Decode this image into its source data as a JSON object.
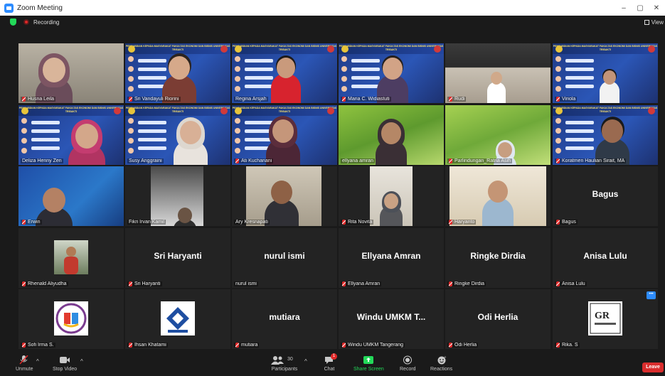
{
  "window": {
    "title": "Zoom Meeting",
    "min": "–",
    "max": "▢",
    "close": "✕"
  },
  "status": {
    "recording": "Recording",
    "view": "View"
  },
  "slide_banner": "PENGABDIAN KEPADA MASYARAKAT FAKULTAS EKONOMI DAN BISNIS UNIVERSITAS TRISAKTI",
  "participants": [
    {
      "name": "Husna Leila",
      "kind": "camera",
      "muted": true
    },
    {
      "name": "Sri Vandayuli Riorini",
      "kind": "slide",
      "muted": true
    },
    {
      "name": "Regina Arsjah",
      "kind": "slide",
      "muted": false
    },
    {
      "name": "Maria C. Widiastuti",
      "kind": "slide",
      "muted": true
    },
    {
      "name": "Rudi",
      "kind": "camera",
      "muted": true
    },
    {
      "name": "Viriola",
      "kind": "slide",
      "muted": true
    },
    {
      "name": "Deliza Henny Zen",
      "kind": "slide",
      "muted": false
    },
    {
      "name": "Susy Anggraini",
      "kind": "slide",
      "muted": false
    },
    {
      "name": "Ati Kuchariani",
      "kind": "slide",
      "muted": true
    },
    {
      "name": "ellyana amran",
      "kind": "camera",
      "muted": false
    },
    {
      "name": "Parlindungan_Ratna Asih",
      "kind": "camera",
      "muted": true
    },
    {
      "name": "Koratmen Haulian Sirait, MA",
      "kind": "slide",
      "muted": true
    },
    {
      "name": "Erwin",
      "kind": "camera",
      "muted": true
    },
    {
      "name": "Fikri Irvan Kamil",
      "kind": "camera",
      "muted": false
    },
    {
      "name": "Ary Kresnapati",
      "kind": "camera",
      "muted": false
    },
    {
      "name": "Rita Novita",
      "kind": "camera",
      "muted": true
    },
    {
      "name": "Haryanto",
      "kind": "camera",
      "muted": true
    },
    {
      "name": "Bagus",
      "kind": "name",
      "display": "Bagus",
      "muted": true
    },
    {
      "name": "Rhenald Aliyudha",
      "kind": "avatar",
      "muted": true
    },
    {
      "name": "Sri Haryanti",
      "kind": "name",
      "display": "Sri Haryanti",
      "muted": true
    },
    {
      "name": "nurul ismi",
      "kind": "name",
      "display": "nurul ismi",
      "muted": false
    },
    {
      "name": "Ellyana Amran",
      "kind": "name",
      "display": "Ellyana Amran",
      "muted": true
    },
    {
      "name": "Ringke Dirdia",
      "kind": "name",
      "display": "Ringke Dirdia",
      "muted": true
    },
    {
      "name": "Anisa Lulu",
      "kind": "name",
      "display": "Anisa Lulu",
      "muted": true
    },
    {
      "name": "Sofi Irma S.",
      "kind": "avatar",
      "muted": true
    },
    {
      "name": "Ihsan Khatami",
      "kind": "avatar",
      "muted": true
    },
    {
      "name": "mutiara",
      "kind": "name",
      "display": "mutiara",
      "muted": true
    },
    {
      "name": "Windu UMKM Tangerang",
      "kind": "name",
      "display": "Windu UMKM T...",
      "muted": true
    },
    {
      "name": "Odi Herlia",
      "kind": "name",
      "display": "Odi Herlia",
      "muted": true
    },
    {
      "name": "Rika. S",
      "kind": "avatar",
      "muted": true
    }
  ],
  "toolbar": {
    "unmute": "Unmute",
    "stop_video": "Stop Video",
    "participants": "Participants",
    "participants_count": "30",
    "chat": "Chat",
    "chat_badge": "1",
    "share_screen": "Share Screen",
    "record": "Record",
    "reactions": "Reactions",
    "leave": "Leave"
  },
  "colors": {
    "active_speaker": "#f2e836",
    "leave": "#d92d2d",
    "share": "#23d959",
    "accent": "#2d8cff"
  }
}
